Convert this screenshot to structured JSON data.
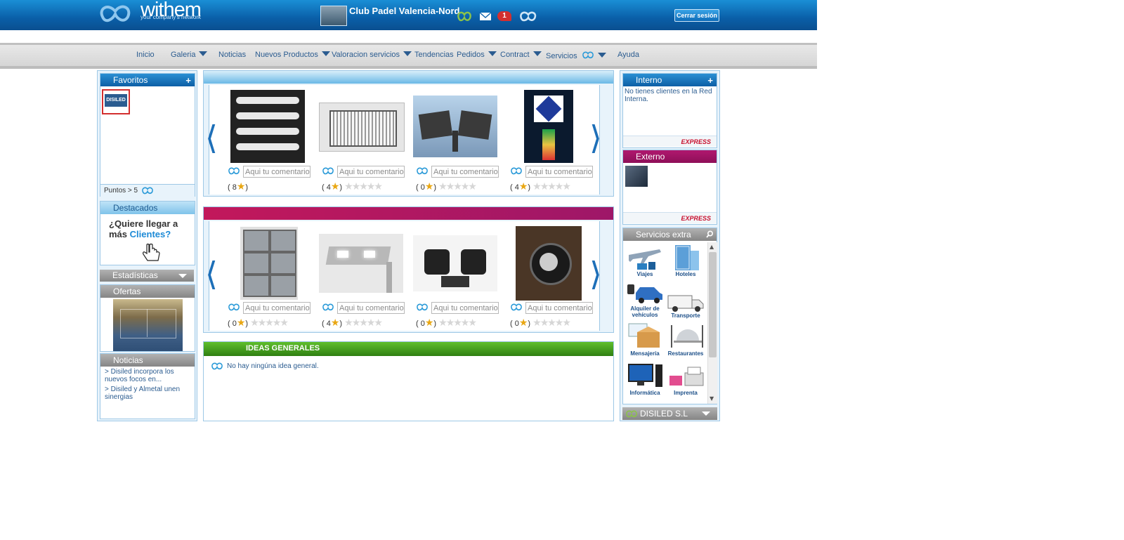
{
  "header": {
    "logo_text": "withem",
    "logo_sub": "your company's network",
    "club_name": "Club Padel Valencia-Nord",
    "notification_count": "1",
    "logout_label": "Cerrar sesión"
  },
  "nav": {
    "items": [
      {
        "label": "Inicio"
      },
      {
        "label": "Galeria"
      },
      {
        "label": "Noticias"
      },
      {
        "label": "Nuevos Productos"
      },
      {
        "label": "Valoracion servicios"
      },
      {
        "label": "Tendencias"
      },
      {
        "label": "Pedidos"
      },
      {
        "label": "Contract"
      },
      {
        "label": "Servicios"
      },
      {
        "label": "Ayuda"
      }
    ]
  },
  "left": {
    "favoritos_title": "Favoritos",
    "favorito_logo_text": "DISILED",
    "puntos_label": "Puntos > 5",
    "destacados_title": "Destacados",
    "destacados_line1": "¿Quiere llegar a",
    "destacados_line2a": "más",
    "destacados_line2b": "Clientes?",
    "estadisticas_title": "Estadísticas",
    "ofertas_title": "Ofertas",
    "noticias_title": "Noticias",
    "noticias": [
      {
        "text": "> Disiled incorpora los nuevos focos en..."
      },
      {
        "text": "> Disiled y Almetal unen sinergias"
      }
    ]
  },
  "center": {
    "comment_placeholder": "Aqui tu comentario",
    "carousel1": {
      "ratings": [
        {
          "pre": "(",
          "count": "8",
          "post": ")"
        },
        {
          "pre": "(",
          "count": "4",
          "post": ")"
        },
        {
          "pre": "(",
          "count": "0",
          "post": ")"
        },
        {
          "pre": "(",
          "count": "4",
          "post": ")"
        }
      ]
    },
    "carousel2": {
      "ratings": [
        {
          "pre": "(",
          "count": "0",
          "post": ")"
        },
        {
          "pre": "(",
          "count": "4",
          "post": ")"
        },
        {
          "pre": "(",
          "count": "0",
          "post": ")"
        },
        {
          "pre": "(",
          "count": "0",
          "post": ")"
        }
      ]
    },
    "ideas_title": "IDEAS GENERALES",
    "ideas_empty": "No hay ningúna idea general."
  },
  "right": {
    "interno_title": "Interno",
    "interno_empty": "No tienes clientes en la Red Interna.",
    "express_label": "EXPRESS",
    "externo_title": "Externo",
    "servicios_title": "Servicios extra",
    "servicios": [
      {
        "label": "Viajes"
      },
      {
        "label": "Hoteles"
      },
      {
        "label": "Alquiler de vehículos"
      },
      {
        "label": "Transporte"
      },
      {
        "label": "Mensajería"
      },
      {
        "label": "Restaurantes"
      },
      {
        "label": "Informática"
      },
      {
        "label": "Imprenta"
      }
    ],
    "company_title": "DISILED S.L"
  },
  "colors": {
    "header_blue": "#0a5fa8",
    "accent_magenta": "#c2185b",
    "ideas_green": "#3f9a1e",
    "link_blue": "#2b5c90"
  },
  "icons": [
    "withem-logo-icon",
    "chat-icon",
    "mail-icon",
    "notification-icon",
    "network-icon",
    "caret-down-icon",
    "plus-icon",
    "search-icon",
    "star-icon",
    "arrow-left-icon",
    "arrow-right-icon"
  ]
}
